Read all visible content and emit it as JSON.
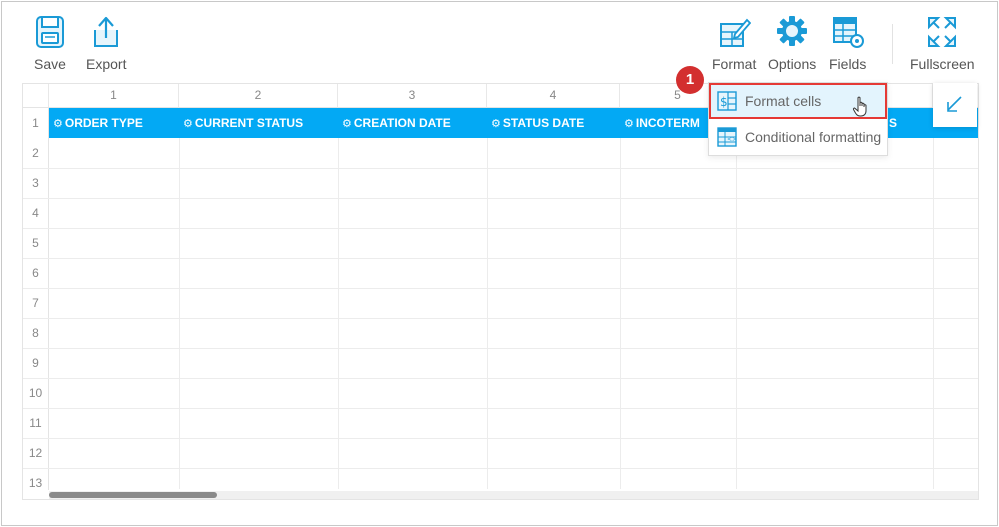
{
  "toolbar": {
    "save": "Save",
    "export": "Export",
    "format": "Format",
    "options": "Options",
    "fields": "Fields",
    "fullscreen": "Fullscreen"
  },
  "grid": {
    "column_numbers": [
      "1",
      "2",
      "3",
      "4",
      "5"
    ],
    "row_numbers": [
      "1",
      "2",
      "3",
      "4",
      "5",
      "6",
      "7",
      "8",
      "9",
      "10",
      "11",
      "12",
      "13"
    ],
    "headers": [
      "ORDER TYPE",
      "CURRENT STATUS",
      "CREATION DATE",
      "STATUS DATE",
      "INCOTERM",
      "S"
    ]
  },
  "format_menu": {
    "items": [
      {
        "label": "Format cells",
        "icon": "format-cells-icon"
      },
      {
        "label": "Conditional formatting",
        "icon": "conditional-formatting-icon"
      }
    ]
  },
  "callout": {
    "number": "1"
  },
  "colors": {
    "header_band": "#03a9f4",
    "icon_blue": "#1a9ad6",
    "highlight_border": "#e53935",
    "callout": "#d32f2f"
  }
}
